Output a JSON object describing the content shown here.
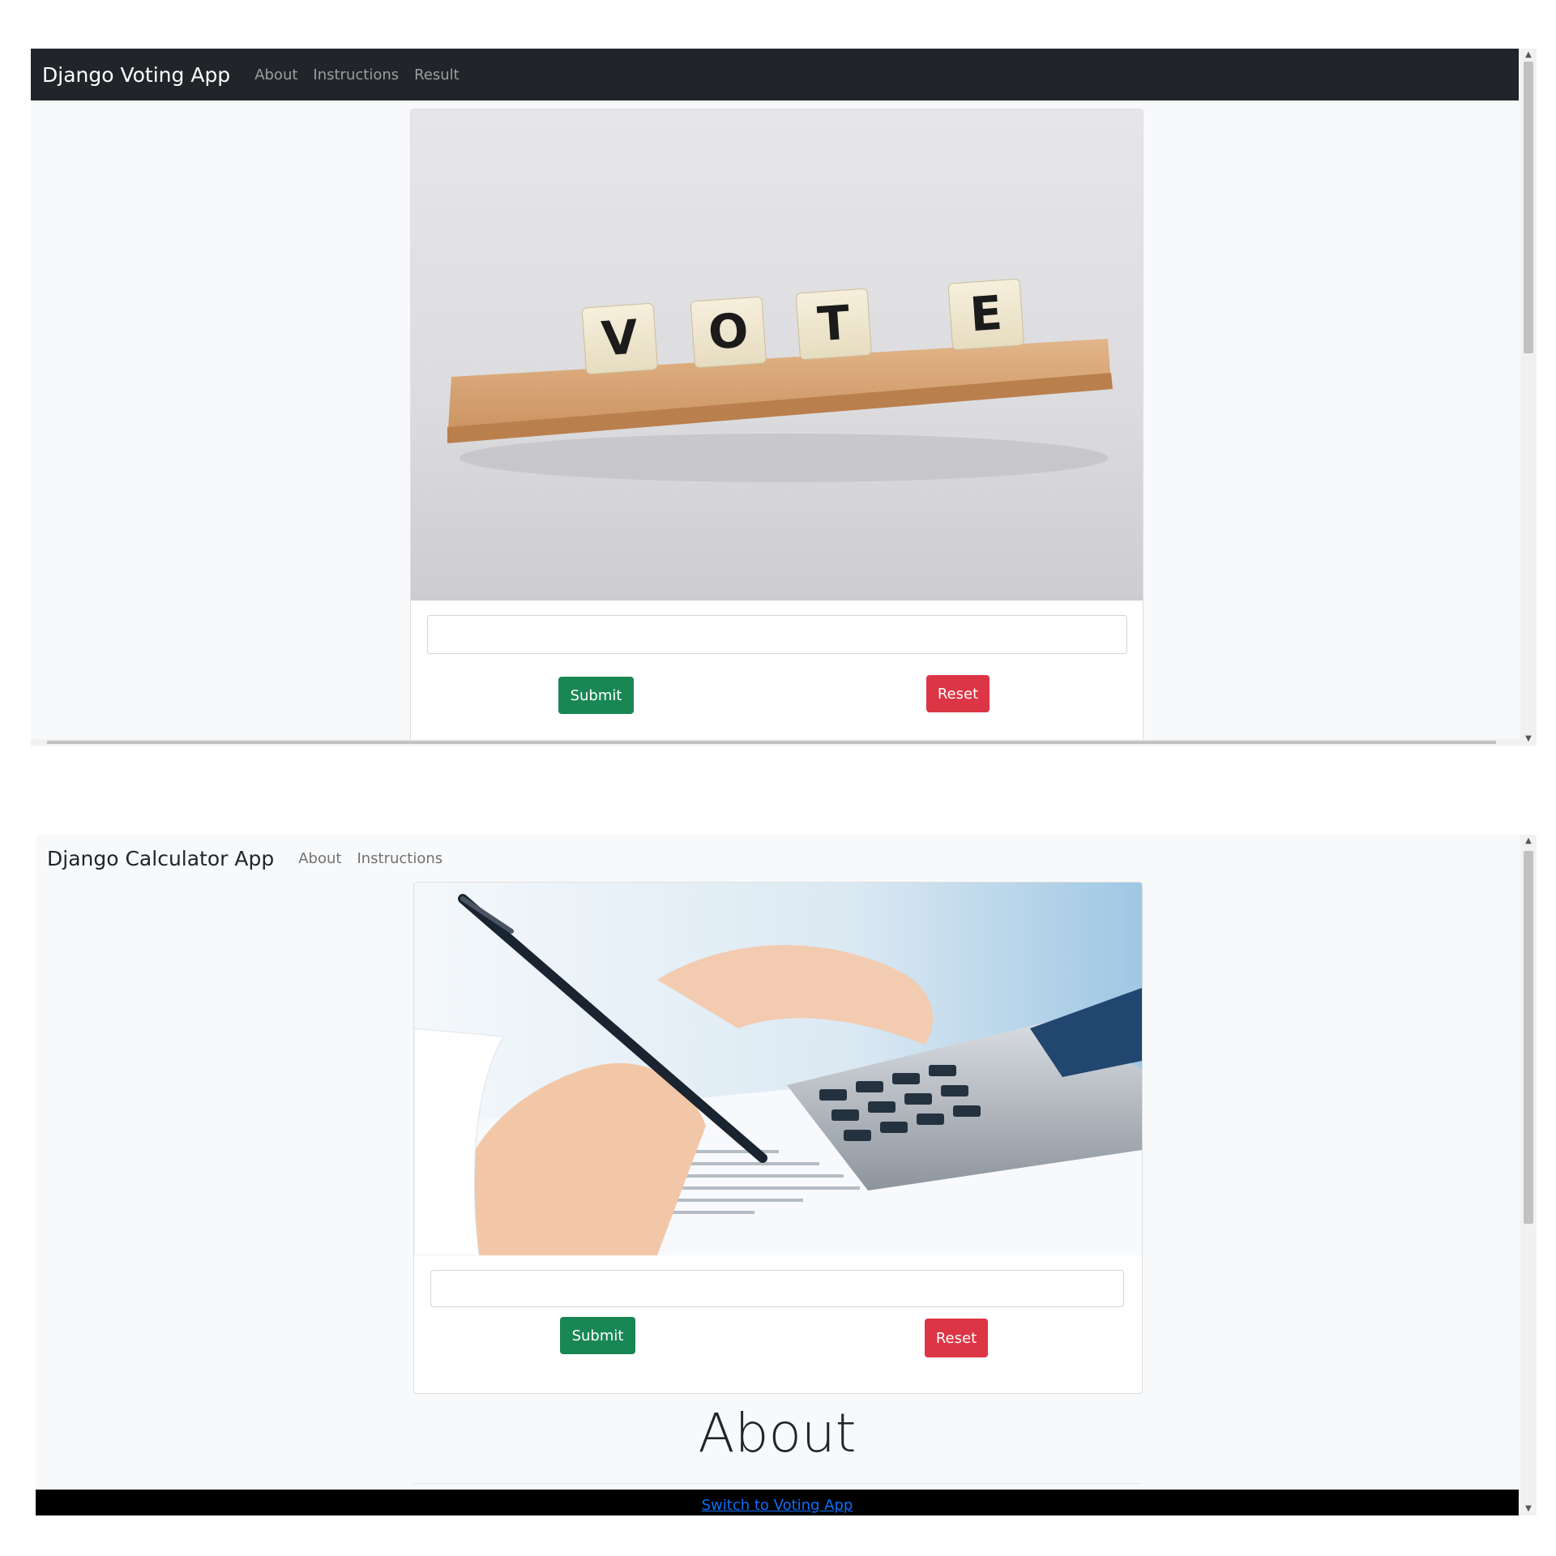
{
  "voting_app": {
    "brand": "Django Voting App",
    "nav_links": [
      "About",
      "Instructions",
      "Result"
    ],
    "image_tiles": [
      "V",
      "O",
      "T",
      "E"
    ],
    "input": {
      "value": "",
      "placeholder": ""
    },
    "submit_label": "Submit",
    "reset_label": "Reset"
  },
  "calculator_app": {
    "brand": "Django Calculator App",
    "nav_links": [
      "About",
      "Instructions"
    ],
    "input": {
      "value": "",
      "placeholder": ""
    },
    "submit_label": "Submit",
    "reset_label": "Reset",
    "about_heading": "About",
    "footer_link": "Switch to Voting App"
  },
  "colors": {
    "navbar_dark": "#212529",
    "page_bg": "#f8f9fa",
    "success": "#198754",
    "danger": "#dc3545",
    "link": "#0d6efd"
  },
  "icons": [
    "scroll-up-arrow-icon",
    "scroll-down-arrow-icon"
  ]
}
